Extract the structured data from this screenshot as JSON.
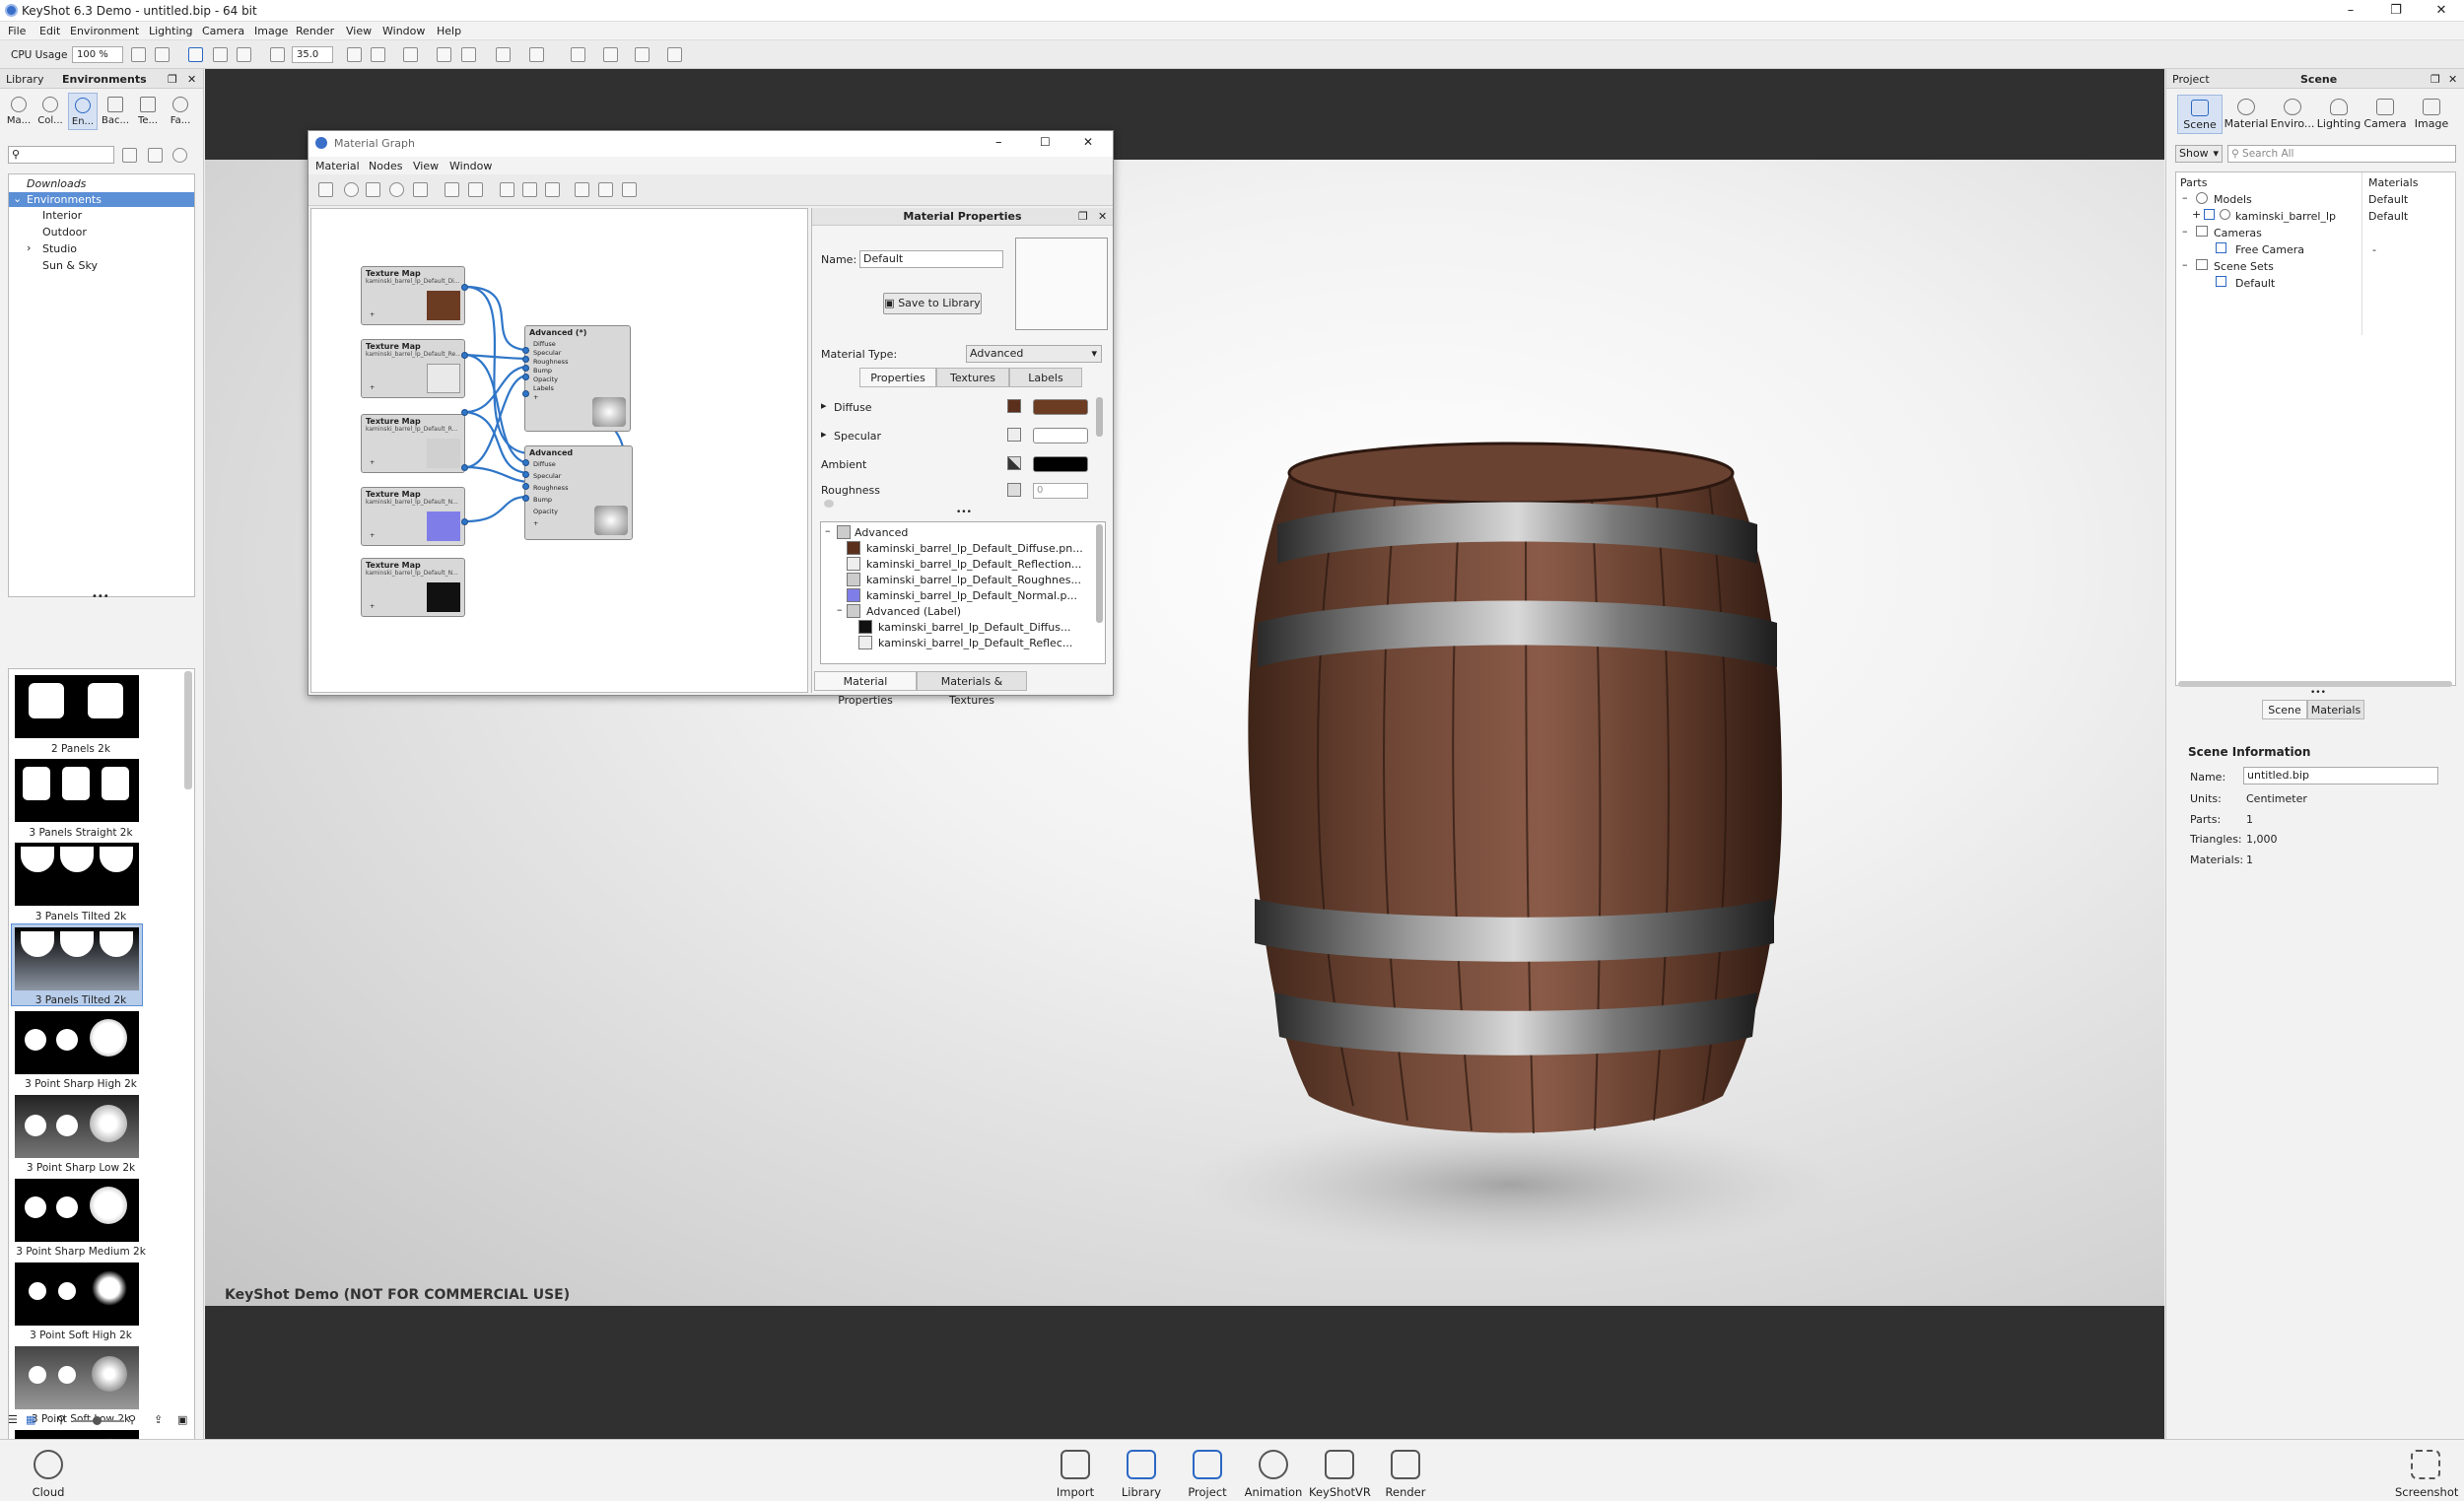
{
  "window": {
    "title": "KeyShot 6.3 Demo - untitled.bip - 64 bit",
    "minimize": "–",
    "maximize": "❐",
    "close": "✕"
  },
  "menu": [
    "File",
    "Edit",
    "Environment",
    "Lighting",
    "Camera",
    "Image",
    "Render",
    "View",
    "Window",
    "Help"
  ],
  "toolbar": {
    "cpu_label": "CPU Usage",
    "cpu_value": "100 %",
    "fov_value": "35.0"
  },
  "library": {
    "header": "Library",
    "title": "Environments",
    "tabs": [
      "Ma...",
      "Col...",
      "En...",
      "Bac...",
      "Te...",
      "Fa..."
    ],
    "tree": {
      "downloads": "Downloads",
      "environments": "Environments",
      "children": [
        "Interior",
        "Outdoor",
        "Studio",
        "Sun & Sky"
      ]
    },
    "thumbnails": [
      "2 Panels 2k",
      "3 Panels Straight 2k",
      "3 Panels Tilted 2k",
      "3 Panels Tilted 2k",
      "3 Point Sharp High 2k",
      "3 Point Sharp Low 2k",
      "3 Point Sharp Medium 2k",
      "3 Point Soft High 2k",
      "3 Point Soft Low 2k"
    ]
  },
  "viewport": {
    "watermark": "KeyShot Demo (NOT FOR COMMERCIAL USE)"
  },
  "material_graph": {
    "title": "Material Graph",
    "menu": [
      "Material",
      "Nodes",
      "View",
      "Window"
    ],
    "nodes": [
      {
        "title": "Texture Map",
        "sub": "kaminski_barrel_lp_Default_Di...",
        "color": "#6b3b22"
      },
      {
        "title": "Texture Map",
        "sub": "kaminski_barrel_lp_Default_Re...",
        "color": "#e9e9e9"
      },
      {
        "title": "Texture Map",
        "sub": "kaminski_barrel_lp_Default_R...",
        "color": "#d0d0d0"
      },
      {
        "title": "Texture Map",
        "sub": "kaminski_barrel_lp_Default_N...",
        "color": "#7f7ee8"
      },
      {
        "title": "Texture Map",
        "sub": "kaminski_barrel_lp_Default_N...",
        "color": "#111111"
      }
    ],
    "advanced_main": {
      "title": "Advanced (*)",
      "ports": [
        "Diffuse",
        "Specular",
        "Roughness",
        "Bump",
        "Opacity",
        "Labels"
      ]
    },
    "advanced_sub": {
      "title": "Advanced",
      "ports": [
        "Diffuse",
        "Specular",
        "Roughness",
        "Bump",
        "Opacity"
      ]
    },
    "plus": "+"
  },
  "material_properties": {
    "header": "Material Properties",
    "name_label": "Name:",
    "name_value": "Default",
    "save_button": "Save to Library",
    "type_label": "Material Type:",
    "type_value": "Advanced",
    "tabs": [
      "Properties",
      "Textures",
      "Labels"
    ],
    "rows": {
      "diffuse": "Diffuse",
      "specular": "Specular",
      "ambient": "Ambient",
      "roughness": "Roughness",
      "roughness_value": "0"
    },
    "list": [
      "Advanced",
      "kaminski_barrel_lp_Default_Diffuse.pn...",
      "kaminski_barrel_lp_Default_Reflection...",
      "kaminski_barrel_lp_Default_Roughnes...",
      "kaminski_barrel_lp_Default_Normal.p...",
      "Advanced (Label)",
      "kaminski_barrel_lp_Default_Diffus...",
      "kaminski_barrel_lp_Default_Reflec..."
    ],
    "bottom_tabs": [
      "Material Properties",
      "Materials & Textures"
    ]
  },
  "project": {
    "header": "Project",
    "title": "Scene",
    "tabs": [
      "Scene",
      "Material",
      "Enviro...",
      "Lighting",
      "Camera",
      "Image"
    ],
    "show_label": "Show",
    "search_placeholder": "Search All",
    "col_parts": "Parts",
    "col_materials": "Materials",
    "tree": {
      "models": "Models",
      "models_mat": "Default",
      "model_item": "kaminski_barrel_lp",
      "model_item_mat": "Default",
      "cameras": "Cameras",
      "camera_item": "Free Camera",
      "camera_item_mat": "-",
      "scene_sets": "Scene Sets",
      "scene_set_item": "Default"
    },
    "sub_tabs": [
      "Scene",
      "Materials"
    ],
    "info": {
      "title": "Scene Information",
      "name_label": "Name:",
      "name_value": "untitled.bip",
      "units_label": "Units:",
      "units_value": "Centimeter",
      "parts_label": "Parts:",
      "parts_value": "1",
      "triangles_label": "Triangles:",
      "triangles_value": "1,000",
      "materials_label": "Materials:",
      "materials_value": "1"
    }
  },
  "dock": {
    "cloud_library": "Cloud Library",
    "items": [
      "Import",
      "Library",
      "Project",
      "Animation",
      "KeyShotVR",
      "Render"
    ],
    "screenshot": "Screenshot"
  }
}
